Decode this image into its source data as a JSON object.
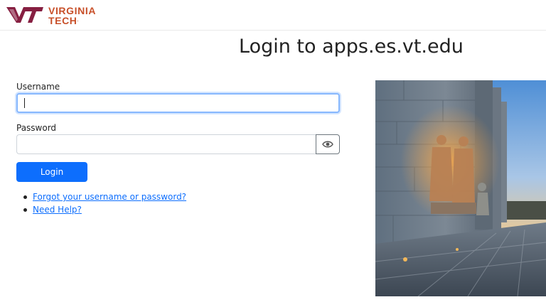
{
  "header": {
    "brand_line1": "VIRGINIA",
    "brand_line2": "TECH",
    "brand_mark": "VT",
    "brand_color": "#C8502A"
  },
  "page": {
    "title": "Login to apps.es.vt.edu"
  },
  "form": {
    "username_label": "Username",
    "username_value": "",
    "password_label": "Password",
    "password_value": "",
    "show_password_icon": "eye-icon",
    "login_label": "Login",
    "login_color": "#0D6EFD"
  },
  "links": {
    "forgot": "Forgot your username or password?",
    "help": "Need Help?"
  },
  "photo": {
    "subject": "campus-stone-building-with-statues-at-sunset"
  }
}
